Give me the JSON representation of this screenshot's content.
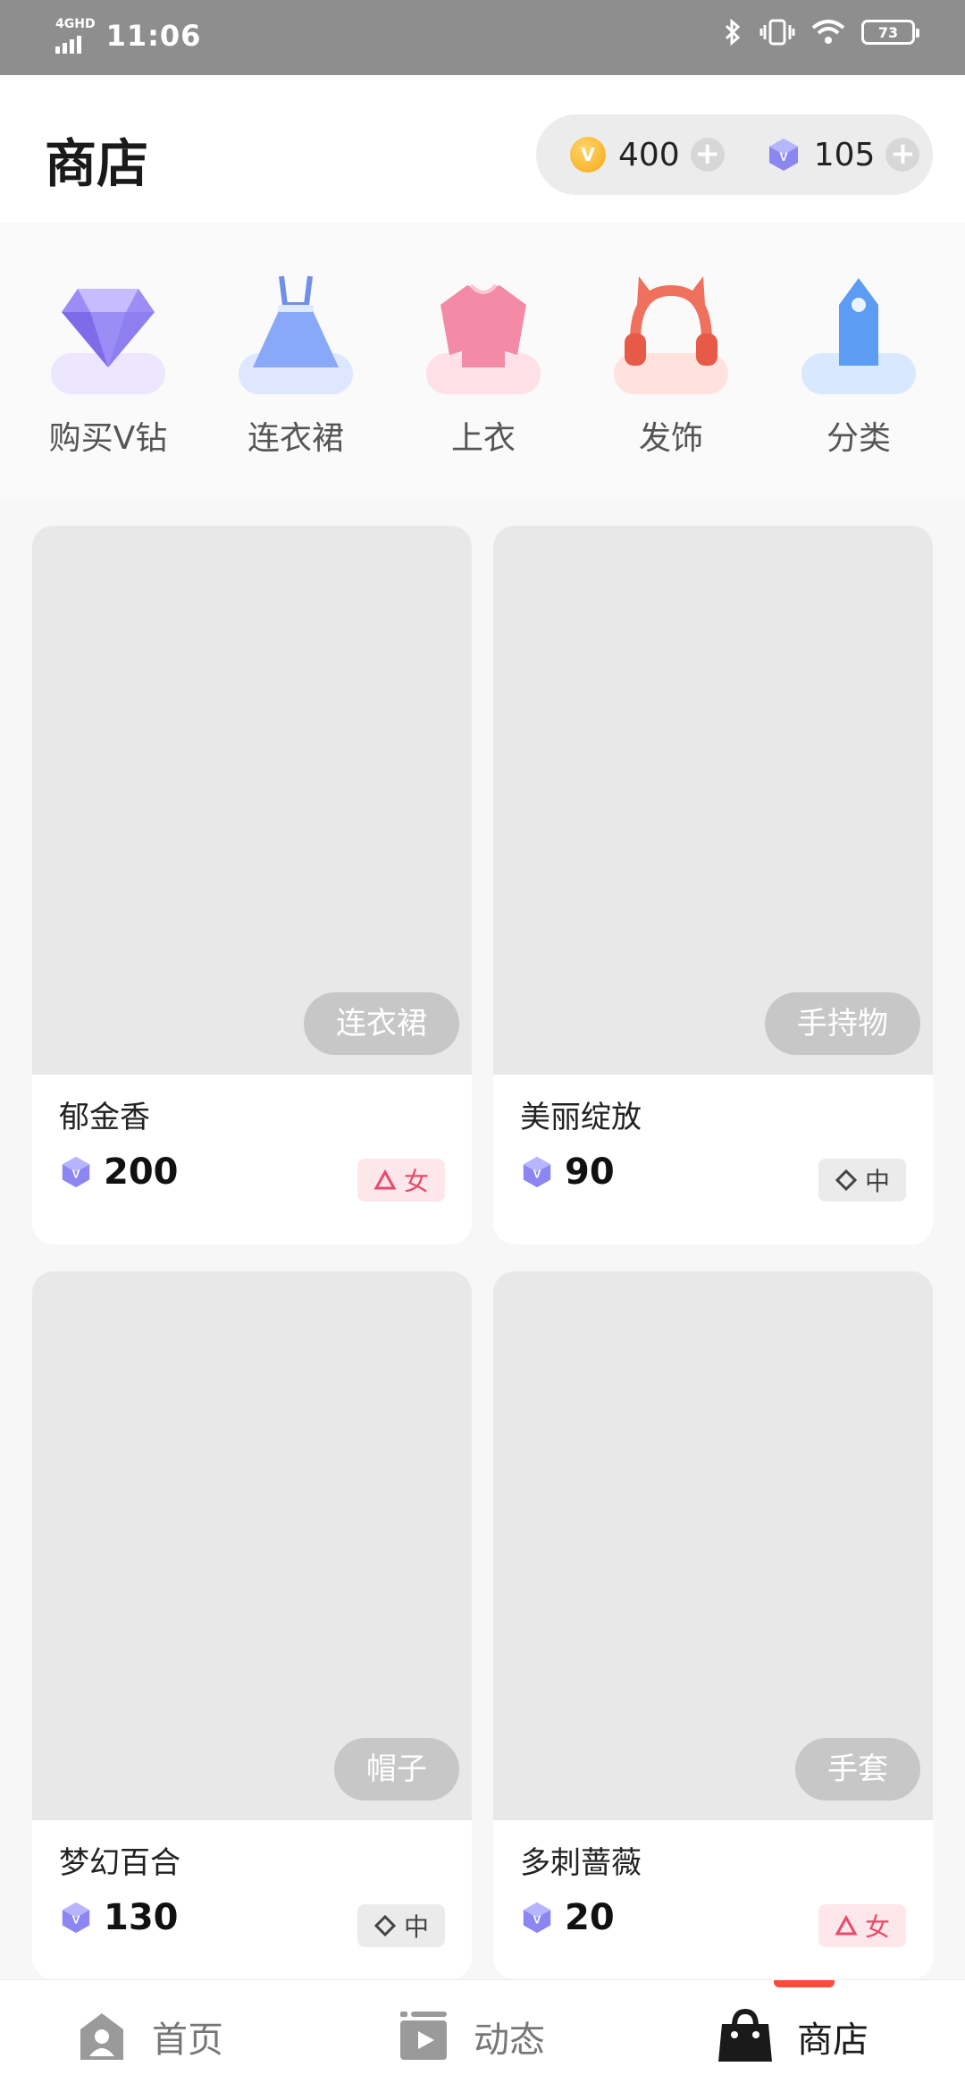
{
  "status_bar": {
    "network": "4GHD",
    "time": "11:06",
    "battery": "73"
  },
  "header": {
    "title": "商店",
    "coins": "400",
    "diamonds": "105"
  },
  "categories": [
    {
      "label": "购买V钻",
      "icon": "diamond-icon"
    },
    {
      "label": "连衣裙",
      "icon": "dress-icon"
    },
    {
      "label": "上衣",
      "icon": "top-shirt-icon"
    },
    {
      "label": "发饰",
      "icon": "headphones-cat-ears-icon"
    },
    {
      "label": "分类",
      "icon": "tag-icon"
    }
  ],
  "products": [
    {
      "name": "郁金香",
      "tag": "连衣裙",
      "price": "200",
      "gender": "女",
      "gender_type": "female"
    },
    {
      "name": "美丽绽放",
      "tag": "手持物",
      "price": "90",
      "gender": "中",
      "gender_type": "neutral"
    },
    {
      "name": "梦幻百合",
      "tag": "帽子",
      "price": "130",
      "gender": "中",
      "gender_type": "neutral"
    },
    {
      "name": "多刺蔷薇",
      "tag": "手套",
      "price": "20",
      "gender": "女",
      "gender_type": "female"
    }
  ],
  "bottom_nav": {
    "home": "首页",
    "feed": "动态",
    "shop": "商店",
    "active": "shop"
  },
  "colors": {
    "accent": "#ff4a3a",
    "gem": "#7b7ff0",
    "coin": "#f6a915",
    "female_badge": "#e94a6a"
  }
}
